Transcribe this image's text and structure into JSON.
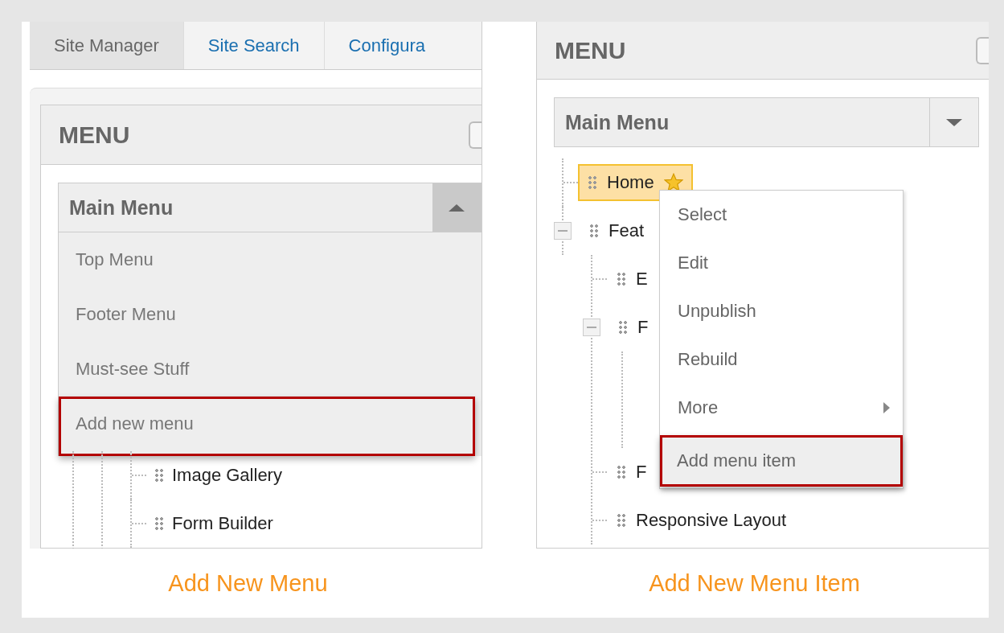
{
  "left": {
    "tabs": [
      {
        "label": "Site Manager",
        "selected": true
      },
      {
        "label": "Site Search",
        "selected": false
      },
      {
        "label": "Configura",
        "selected": false
      }
    ],
    "panel_title": "MENU",
    "dropdown": {
      "value": "Main Menu",
      "expanded": true,
      "options": [
        {
          "label": "Top Menu",
          "highlighted": false
        },
        {
          "label": "Footer Menu",
          "highlighted": false
        },
        {
          "label": "Must-see Stuff",
          "highlighted": false
        },
        {
          "label": "Add new menu",
          "highlighted": true
        }
      ]
    },
    "tree": [
      {
        "label": "Image Gallery"
      },
      {
        "label": "Form Builder"
      }
    ],
    "caption": "Add New Menu"
  },
  "right": {
    "panel_title": "MENU",
    "dropdown": {
      "value": "Main Menu",
      "expanded": false
    },
    "tree": [
      {
        "label": "Home",
        "selected": true,
        "default": true
      },
      {
        "label": "Feat",
        "selected": false,
        "expanded": true,
        "children": [
          {
            "label": "E",
            "selected": false
          },
          {
            "label": "F",
            "selected": false,
            "expanded": true
          },
          {
            "label": "F",
            "selected": false
          },
          {
            "label": "Responsive Layout",
            "selected": false
          }
        ]
      }
    ],
    "context_menu": [
      {
        "label": "Select",
        "highlighted": false,
        "submenu": false
      },
      {
        "label": "Edit",
        "highlighted": false,
        "submenu": false
      },
      {
        "label": "Unpublish",
        "highlighted": false,
        "submenu": false
      },
      {
        "label": "Rebuild",
        "highlighted": false,
        "submenu": false
      },
      {
        "label": "More",
        "highlighted": false,
        "submenu": true
      },
      {
        "label": "Add menu item",
        "highlighted": true,
        "submenu": false
      }
    ],
    "caption": "Add New Menu Item"
  }
}
